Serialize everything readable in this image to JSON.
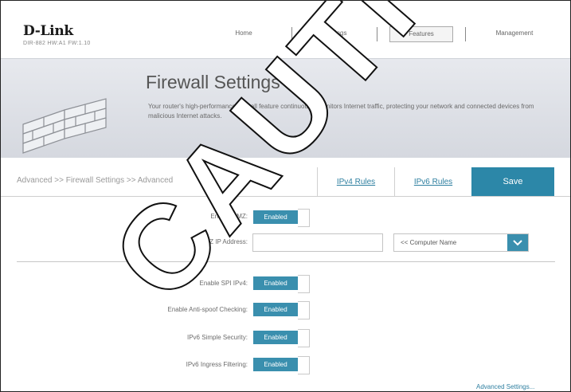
{
  "header": {
    "logo": "D-Link",
    "model": "DIR-882 HW:A1 FW:1.10",
    "nav": {
      "home": "Home",
      "settings": "Settings",
      "features": "Features",
      "management": "Management"
    }
  },
  "banner": {
    "title": "Firewall Settings",
    "description": "Your router's high-performance firewall feature continuously monitors Internet traffic, protecting your network and connected devices from malicious Internet attacks."
  },
  "breadcrumb": "Advanced >> Firewall Settings >> Advanced",
  "tabs": {
    "ipv4": "IPv4 Rules",
    "ipv6": "IPv6 Rules",
    "save": "Save"
  },
  "form": {
    "enable_dmz": {
      "label": "Enable DMZ:",
      "state": "Enabled"
    },
    "dmz_ip": {
      "label": "DMZ IP Address:",
      "value": "",
      "select_value": "<< Computer Name"
    },
    "spi_ipv4": {
      "label": "Enable SPI IPv4:",
      "state": "Enabled"
    },
    "anti_spoof": {
      "label": "Enable Anti-spoof Checking:",
      "state": "Enabled"
    },
    "ipv6_simple_security": {
      "label": "IPv6 Simple Security:",
      "state": "Enabled"
    },
    "ipv6_ingress_filtering": {
      "label": "IPv6 Ingress Filtering:",
      "state": "Enabled"
    }
  },
  "advanced_link": "Advanced Settings...",
  "watermark": "CAUTION",
  "colors": {
    "accent": "#2c87a8",
    "toggle": "#3a8fae",
    "link": "#2e7fa0"
  }
}
